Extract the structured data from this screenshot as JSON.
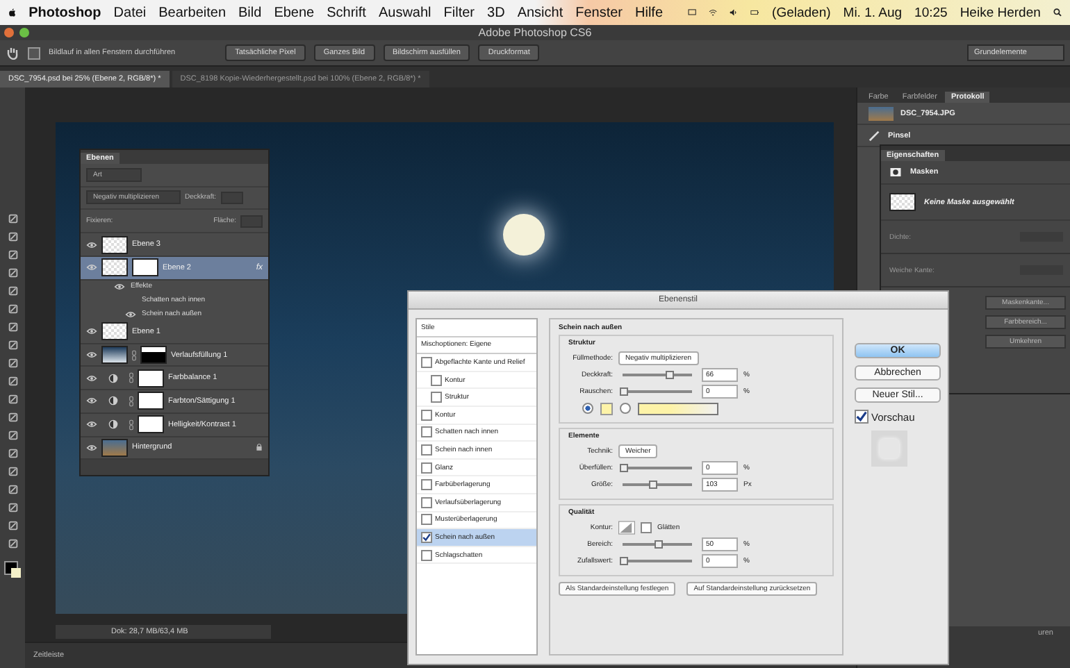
{
  "menubar": {
    "app": "Photoshop",
    "menus": [
      "Datei",
      "Bearbeiten",
      "Bild",
      "Ebene",
      "Schrift",
      "Auswahl",
      "Filter",
      "3D",
      "Ansicht",
      "Fenster",
      "Hilfe"
    ],
    "battery": "(Geladen)",
    "date": "Mi. 1. Aug",
    "time": "10:25",
    "user": "Heike Herden"
  },
  "window": {
    "title": "Adobe Photoshop CS6"
  },
  "options_bar": {
    "scroll_all": {
      "label": "Bildlauf in allen Fenstern durchführen",
      "checked": false
    },
    "buttons": [
      "Tatsächliche Pixel",
      "Ganzes Bild",
      "Bildschirm ausfüllen",
      "Druckformat"
    ],
    "workspace": "Grundelemente"
  },
  "document_tabs": [
    {
      "label": "DSC_7954.psd bei 25% (Ebene 2, RGB/8*) *",
      "selected": true
    },
    {
      "label": "DSC_8198 Kopie-Wiederhergestellt.psd bei 100% (Ebene 2, RGB/8*) *",
      "selected": false
    }
  ],
  "layers_panel": {
    "title": "Ebenen",
    "filter": "Art",
    "blend_mode": "Negativ multiplizieren",
    "opacity_label": "Deckkraft:",
    "lock_label": "Fixieren:",
    "fill_label": "Fläche:",
    "layers": [
      {
        "name": "Ebene 3",
        "kind": "pixel",
        "visible": true,
        "selected": false
      },
      {
        "name": "Ebene 2",
        "kind": "pixel_mask",
        "visible": true,
        "selected": true,
        "effects": {
          "badge": "fx",
          "title": "Effekte",
          "items": [
            {
              "label": "Schatten nach innen",
              "visible": false
            },
            {
              "label": "Schein nach außen",
              "visible": true
            }
          ]
        }
      },
      {
        "name": "Ebene 1",
        "kind": "pixel",
        "visible": true,
        "selected": false
      },
      {
        "name": "Verlaufsfüllung 1",
        "kind": "fill",
        "visible": true,
        "selected": false
      },
      {
        "name": "Farbbalance 1",
        "kind": "adjustment",
        "visible": true,
        "selected": false
      },
      {
        "name": "Farbton/Sättigung 1",
        "kind": "adjustment",
        "visible": true,
        "selected": false
      },
      {
        "name": "Helligkeit/Kontrast 1",
        "kind": "adjustment",
        "visible": true,
        "selected": false
      },
      {
        "name": "Hintergrund",
        "kind": "background",
        "visible": true,
        "selected": false
      }
    ]
  },
  "history_panel": {
    "tabs": [
      {
        "label": "Farbe",
        "selected": false
      },
      {
        "label": "Farbfelder",
        "selected": false
      },
      {
        "label": "Protokoll",
        "selected": true
      }
    ],
    "items": [
      {
        "label": "DSC_7954.JPG",
        "kind": "snapshot"
      },
      {
        "label": "Pinsel",
        "kind": "brush"
      }
    ]
  },
  "properties_panel": {
    "title": "Eigenschaften",
    "section": "Masken",
    "mask_status": "Keine Maske ausgewählt",
    "fields": [
      "Dichte:",
      "Weiche Kante:"
    ],
    "buttons": [
      "Maskenkante...",
      "Farbbereich...",
      "Umkehren"
    ]
  },
  "lower_dock_tab": "uren",
  "status_bar": {
    "doc_size": "Dok: 28,7 MB/63,4 MB"
  },
  "timeline": {
    "tab": "Zeitleiste"
  },
  "layer_style_dialog": {
    "title": "Ebenenstil",
    "styles": [
      {
        "label": "Stile",
        "kind": "header",
        "selected": false
      },
      {
        "label": "Mischoptionen: Eigene",
        "kind": "header",
        "selected": false
      },
      {
        "label": "Abgeflachte Kante und Relief",
        "kind": "option",
        "checked": false,
        "selected": false
      },
      {
        "label": "Kontur",
        "kind": "suboption",
        "checked": false,
        "selected": false
      },
      {
        "label": "Struktur",
        "kind": "suboption",
        "checked": false,
        "selected": false
      },
      {
        "label": "Kontur",
        "kind": "option",
        "checked": false,
        "selected": false
      },
      {
        "label": "Schatten nach innen",
        "kind": "option",
        "checked": false,
        "selected": false
      },
      {
        "label": "Schein nach innen",
        "kind": "option",
        "checked": false,
        "selected": false
      },
      {
        "label": "Glanz",
        "kind": "option",
        "checked": false,
        "selected": false
      },
      {
        "label": "Farbüberlagerung",
        "kind": "option",
        "checked": false,
        "selected": false
      },
      {
        "label": "Verlaufsüberlagerung",
        "kind": "option",
        "checked": false,
        "selected": false
      },
      {
        "label": "Musterüberlagerung",
        "kind": "option",
        "checked": false,
        "selected": false
      },
      {
        "label": "Schein nach außen",
        "kind": "option",
        "checked": true,
        "selected": true
      },
      {
        "label": "Schlagschatten",
        "kind": "option",
        "checked": false,
        "selected": false
      }
    ],
    "section_title": "Schein nach außen",
    "structure": {
      "title": "Struktur",
      "blend_label": "Füllmethode:",
      "blend_mode": "Negativ multiplizieren",
      "sliders": [
        {
          "label": "Deckkraft:",
          "level": 0.66,
          "value": "66",
          "unit": "%"
        },
        {
          "label": "Rauschen:",
          "level": 0,
          "value": "0",
          "unit": "%"
        }
      ],
      "color_modes": [
        {
          "kind": "color",
          "selected": true
        },
        {
          "kind": "gradient",
          "selected": false
        }
      ]
    },
    "elements": {
      "title": "Elemente",
      "technique_label": "Technik:",
      "technique": "Weicher",
      "sliders": [
        {
          "label": "Überfüllen:",
          "level": 0,
          "value": "0",
          "unit": "%"
        },
        {
          "label": "Größe:",
          "level": 0.41,
          "value": "103",
          "unit": "Px"
        }
      ]
    },
    "quality": {
      "title": "Qualität",
      "contour_label": "Kontur:",
      "anti_alias": {
        "label": "Glätten",
        "checked": false
      },
      "sliders": [
        {
          "label": "Bereich:",
          "level": 0.5,
          "value": "50",
          "unit": "%"
        },
        {
          "label": "Zufallswert:",
          "level": 0,
          "value": "0",
          "unit": "%"
        }
      ]
    },
    "default_buttons": [
      "Als Standardeinstellung festlegen",
      "Auf Standardeinstellung zurücksetzen"
    ],
    "buttons": [
      {
        "label": "OK",
        "kind": "default"
      },
      {
        "label": "Abbrechen",
        "kind": "normal"
      },
      {
        "label": "Neuer Stil...",
        "kind": "normal"
      }
    ],
    "preview": {
      "label": "Vorschau",
      "checked": true
    }
  }
}
